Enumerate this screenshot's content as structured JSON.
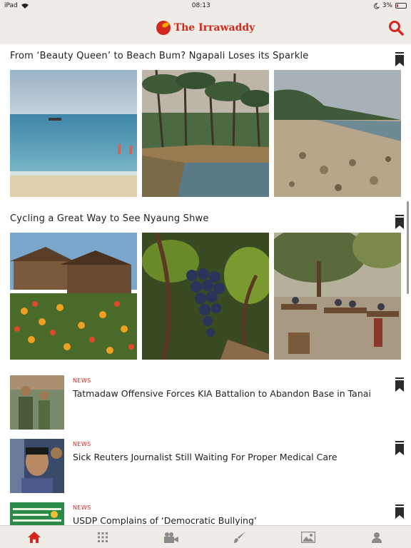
{
  "status_bar": {
    "device": "iPad",
    "time": "08:13",
    "battery": "3%"
  },
  "header": {
    "brand": "The Irrawaddy"
  },
  "galleries": [
    {
      "title": "From ‘Beauty Queen’ to Beach Bum? Ngapali Loses its Sparkle"
    },
    {
      "title": "Cycling a Great Way to See Nyaung Shwe"
    }
  ],
  "news": [
    {
      "category": "NEWS",
      "title": "Tatmadaw Offensive Forces KIA Battalion to Abandon Base in Tanai"
    },
    {
      "category": "NEWS",
      "title": "Sick Reuters Journalist Still Waiting For Proper Medical Care"
    },
    {
      "category": "NEWS",
      "title": "USDP Complains of ‘Democratic Bullying’"
    }
  ],
  "tabs": [
    "home-icon",
    "grid-icon",
    "video-icon",
    "brush-icon",
    "photo-icon",
    "profile-icon"
  ],
  "colors": {
    "accent": "#d4281f",
    "bar_bg": "#efebe6",
    "icon": "#8a8a8a"
  }
}
